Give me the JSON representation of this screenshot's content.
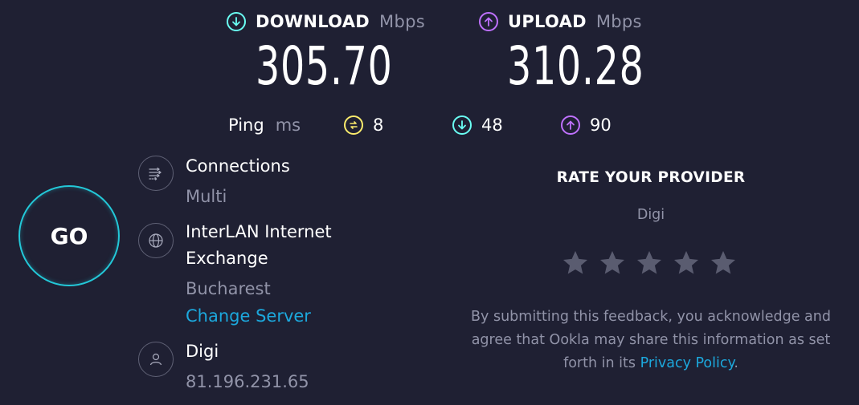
{
  "colors": {
    "background": "#1f2033",
    "download_accent": "#6afff3",
    "upload_accent": "#bf71ff",
    "ping_accent": "#fbeb6c",
    "go_ring": "#23c8d8",
    "link": "#1ca8dd",
    "muted": "#9193a8",
    "star": "#5a5c70"
  },
  "download": {
    "label": "DOWNLOAD",
    "unit": "Mbps",
    "value": "305.70",
    "icon": "arrow-down-circle-icon"
  },
  "upload": {
    "label": "UPLOAD",
    "unit": "Mbps",
    "value": "310.28",
    "icon": "arrow-up-circle-icon"
  },
  "ping": {
    "label": "Ping",
    "unit": "ms",
    "idle": "8",
    "download": "48",
    "upload": "90"
  },
  "go_button": {
    "label": "GO"
  },
  "connections": {
    "title": "Connections",
    "value": "Multi",
    "icon": "connections-icon"
  },
  "server": {
    "name_line1": "InterLAN Internet",
    "name_line2": "Exchange",
    "location": "Bucharest",
    "change_label": "Change Server",
    "icon": "globe-icon"
  },
  "provider": {
    "name": "Digi",
    "ip": "81.196.231.65",
    "icon": "user-icon"
  },
  "rating": {
    "heading": "RATE YOUR PROVIDER",
    "provider": "Digi",
    "stars": 5,
    "selected": 0,
    "feedback_line1": "By submitting this feedback, you acknowledge and",
    "feedback_line2": "agree that Ookla may share this information as set",
    "feedback_line3_prefix": "forth in its",
    "privacy_link": "Privacy Policy",
    "feedback_suffix": "."
  }
}
